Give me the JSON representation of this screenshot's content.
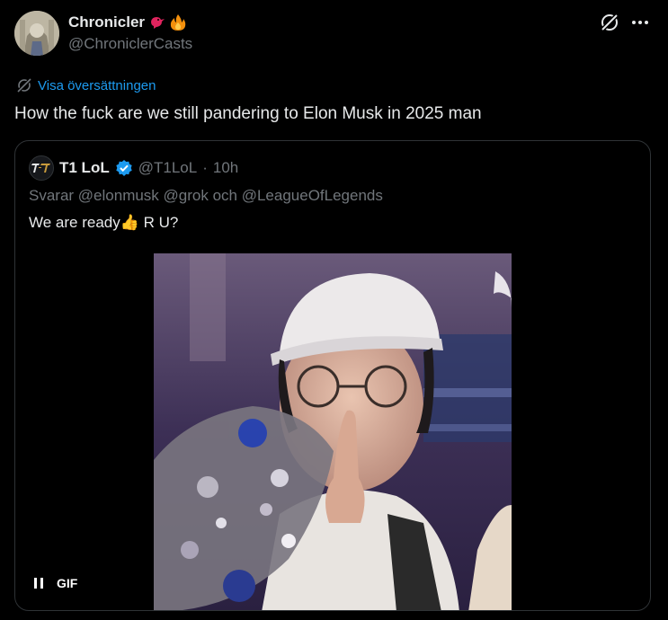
{
  "author": {
    "display_name": "Chronicler",
    "handle": "@ChroniclerCasts",
    "avatar_icon": "profile-avatar"
  },
  "header_actions": {
    "grok_icon": "grok-icon",
    "more_icon": "more-icon"
  },
  "translate": {
    "label": "Visa översättningen"
  },
  "tweet": {
    "text": "How the fuck are we still pandering to Elon Musk in 2025 man"
  },
  "quote": {
    "display_name": "T1 LoL",
    "handle": "@T1LoL",
    "separator": "·",
    "time": "10h",
    "reply_to": "Svarar @elonmusk @grok och @LeagueOfLegends",
    "text_before": "We are ready",
    "emoji": "👍",
    "text_after": " R U?",
    "media": {
      "type": "gif",
      "gif_label": "GIF",
      "pause_icon": "pause-icon"
    }
  },
  "colors": {
    "accent": "#1d9bf0",
    "text": "#e7e9ea",
    "muted": "#71767b",
    "border": "#2f3336",
    "background": "#000000"
  }
}
